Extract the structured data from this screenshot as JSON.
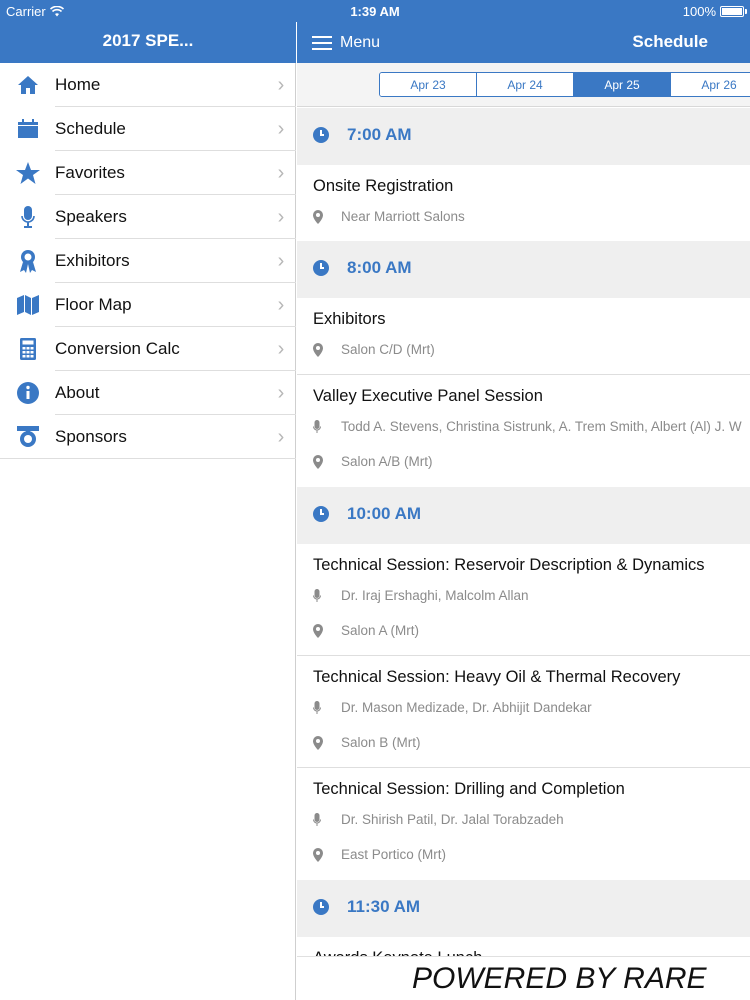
{
  "status": {
    "carrier": "Carrier",
    "time": "1:39 AM",
    "battery": "100%"
  },
  "sidebar": {
    "title": "2017 SPE...",
    "items": [
      {
        "label": "Home",
        "icon": "home-icon"
      },
      {
        "label": "Schedule",
        "icon": "calendar-icon"
      },
      {
        "label": "Favorites",
        "icon": "star-icon"
      },
      {
        "label": "Speakers",
        "icon": "microphone-icon"
      },
      {
        "label": "Exhibitors",
        "icon": "ribbon-icon"
      },
      {
        "label": "Floor Map",
        "icon": "map-icon"
      },
      {
        "label": "Conversion Calc",
        "icon": "calculator-icon"
      },
      {
        "label": "About",
        "icon": "info-icon"
      },
      {
        "label": "Sponsors",
        "icon": "sponsor-icon"
      }
    ]
  },
  "header": {
    "menu_label": "Menu",
    "title": "Schedule"
  },
  "dates": {
    "tabs": [
      "Apr 23",
      "Apr 24",
      "Apr 25",
      "Apr 26"
    ],
    "selected": "Apr 25"
  },
  "schedule": {
    "groups": [
      {
        "time": "7:00 AM",
        "events": [
          {
            "title": "Onsite Registration",
            "speakers": "",
            "location": "Near Marriott Salons"
          }
        ]
      },
      {
        "time": "8:00 AM",
        "events": [
          {
            "title": "Exhibitors",
            "speakers": "",
            "location": "Salon C/D (Mrt)"
          },
          {
            "title": "Valley Executive Panel Session",
            "speakers": "Todd A. Stevens, Christina Sistrunk, A. Trem Smith, Albert (Al) J. W",
            "location": "Salon A/B (Mrt)"
          }
        ]
      },
      {
        "time": "10:00 AM",
        "events": [
          {
            "title": "Technical Session: Reservoir Description & Dynamics",
            "speakers": "Dr. Iraj Ershaghi, Malcolm Allan",
            "location": "Salon A (Mrt)"
          },
          {
            "title": "Technical Session: Heavy Oil & Thermal Recovery",
            "speakers": "Dr. Mason Medizade, Dr. Abhijit Dandekar",
            "location": "Salon B (Mrt)"
          },
          {
            "title": "Technical Session: Drilling and Completion",
            "speakers": "Dr. Shirish Patil, Dr. Jalal Torabzadeh",
            "location": "East Portico (Mrt)"
          }
        ]
      },
      {
        "time": "11:30 AM",
        "events": [
          {
            "title": "Awards Keynote Lunch",
            "speakers": "",
            "location": ""
          }
        ]
      }
    ]
  },
  "footer": {
    "powered": "POWERED BY  RARE"
  },
  "colors": {
    "brand": "#3a78c4",
    "time_header_bg": "#efefef",
    "muted_text": "#8b8b8b"
  }
}
